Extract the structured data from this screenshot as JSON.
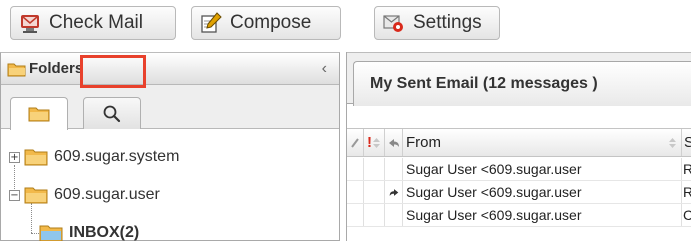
{
  "toolbar": {
    "check_mail": {
      "label": "Check Mail",
      "icon": "check-mail-icon"
    },
    "compose": {
      "label": "Compose",
      "icon": "compose-icon"
    },
    "settings": {
      "label": "Settings",
      "icon": "settings-icon"
    }
  },
  "folders": {
    "title": "Folders",
    "collapse_glyph": "‹",
    "tabs": [
      {
        "name": "folder-tab",
        "icon": "folder-icon",
        "active": true
      },
      {
        "name": "search-tab",
        "icon": "search-icon",
        "active": false,
        "highlighted": true
      }
    ],
    "tree": [
      {
        "label": "609.sugar.system",
        "expander": "+",
        "bold": false
      },
      {
        "label": "609.sugar.user",
        "expander": "−",
        "bold": false
      },
      {
        "label": "INBOX(2)",
        "expander": "",
        "bold": true
      }
    ]
  },
  "email": {
    "tab_title": "My Sent Email (12 messages )",
    "columns": {
      "from": "From",
      "subject_partial": "S"
    },
    "rows": [
      {
        "from": "Sugar User <609.sugar.user",
        "subject_partial": "R",
        "replied": false
      },
      {
        "from": "Sugar User <609.sugar.user",
        "subject_partial": "R",
        "replied": true
      },
      {
        "from": "Sugar User <609.sugar.user",
        "subject_partial": "C",
        "replied": false
      }
    ]
  },
  "colors": {
    "highlight": "#e8412c",
    "folder_icon": "#f2b94a",
    "flag_red": "#d9291b"
  }
}
